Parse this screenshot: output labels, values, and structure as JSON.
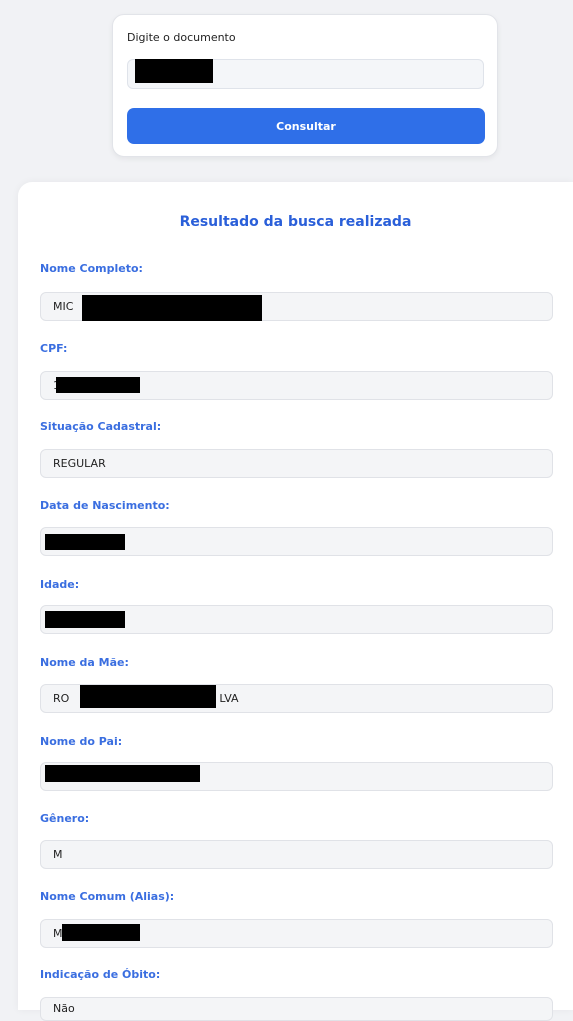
{
  "search": {
    "label": "Digite o documento",
    "value": "",
    "button_label": "Consultar"
  },
  "result": {
    "title": "Resultado da busca realizada",
    "fields": [
      {
        "label": "Nome Completo:",
        "value": "MIC",
        "redacted": true
      },
      {
        "label": "CPF:",
        "value": "1",
        "redacted": true
      },
      {
        "label": "Situação Cadastral:",
        "value": "REGULAR",
        "redacted": false
      },
      {
        "label": "Data de Nascimento:",
        "value": "",
        "redacted": true
      },
      {
        "label": "Idade:",
        "value": "",
        "redacted": true
      },
      {
        "label": "Nome da Mãe:",
        "value": "RO",
        "value_suffix": "LVA",
        "redacted": true
      },
      {
        "label": "Nome do Pai:",
        "value": "",
        "redacted": true
      },
      {
        "label": "Gênero:",
        "value": "M",
        "redacted": false
      },
      {
        "label": "Nome Comum (Alias):",
        "value": "M",
        "redacted": true
      },
      {
        "label": "Indicação de Óbito:",
        "value": "Não",
        "redacted": false
      }
    ]
  },
  "colors": {
    "accent": "#2f6fe8",
    "label": "#3a6ee0",
    "title": "#2a5fd9",
    "background": "#f1f2f5"
  }
}
